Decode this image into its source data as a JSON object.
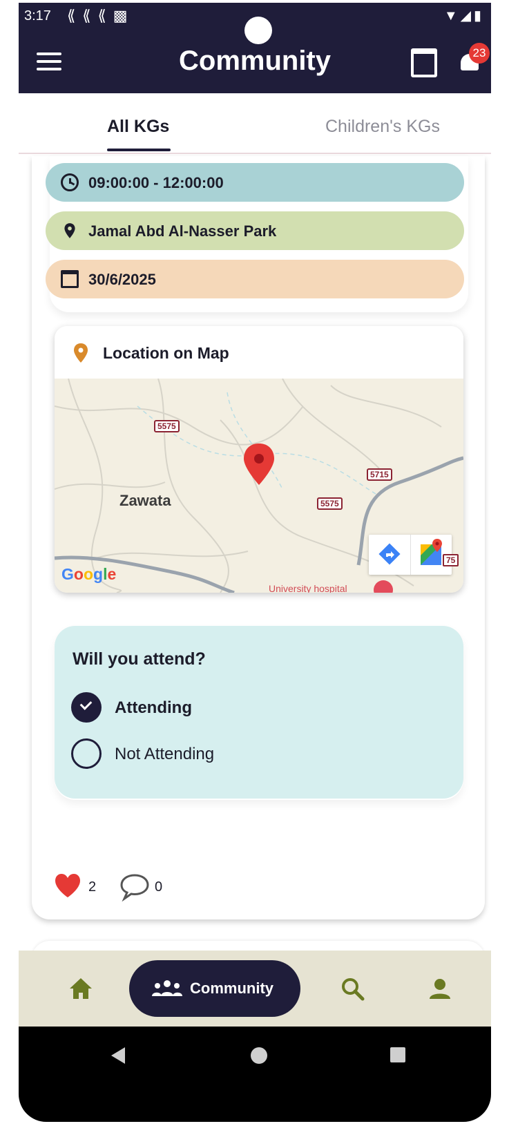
{
  "status_bar": {
    "time": "3:17"
  },
  "app_bar": {
    "title": "Community",
    "notification_count": "23"
  },
  "tabs": [
    {
      "label": "All KGs",
      "selected": true
    },
    {
      "label": "Children's KGs",
      "selected": false
    }
  ],
  "event": {
    "time_range": "09:00:00 - 12:00:00",
    "location": "Jamal Abd Al-Nasser Park",
    "date": "30/6/2025"
  },
  "map": {
    "title": "Location on Map",
    "town_label": "Zawata",
    "road_labels": [
      "5575",
      "5715",
      "5575",
      "75"
    ],
    "google_letters": [
      "G",
      "o",
      "o",
      "g",
      "l",
      "e"
    ],
    "partial_label": "University hospital"
  },
  "attendance": {
    "question": "Will you attend?",
    "options": [
      {
        "label": "Attending",
        "selected": true
      },
      {
        "label": "Not Attending",
        "selected": false
      }
    ]
  },
  "reactions": {
    "likes": "2",
    "comments": "0"
  },
  "bottom_nav": {
    "community_label": "Community",
    "active": "community"
  },
  "colors": {
    "primary": "#1f1d3a",
    "time_pill": "#a9d2d5",
    "location_pill": "#d2dfb0",
    "date_pill": "#f5d8b9",
    "attend_bg": "#d6efef",
    "nav_bg": "#e6e3d2",
    "nav_icon": "#6a7a22",
    "heart": "#e53935"
  }
}
